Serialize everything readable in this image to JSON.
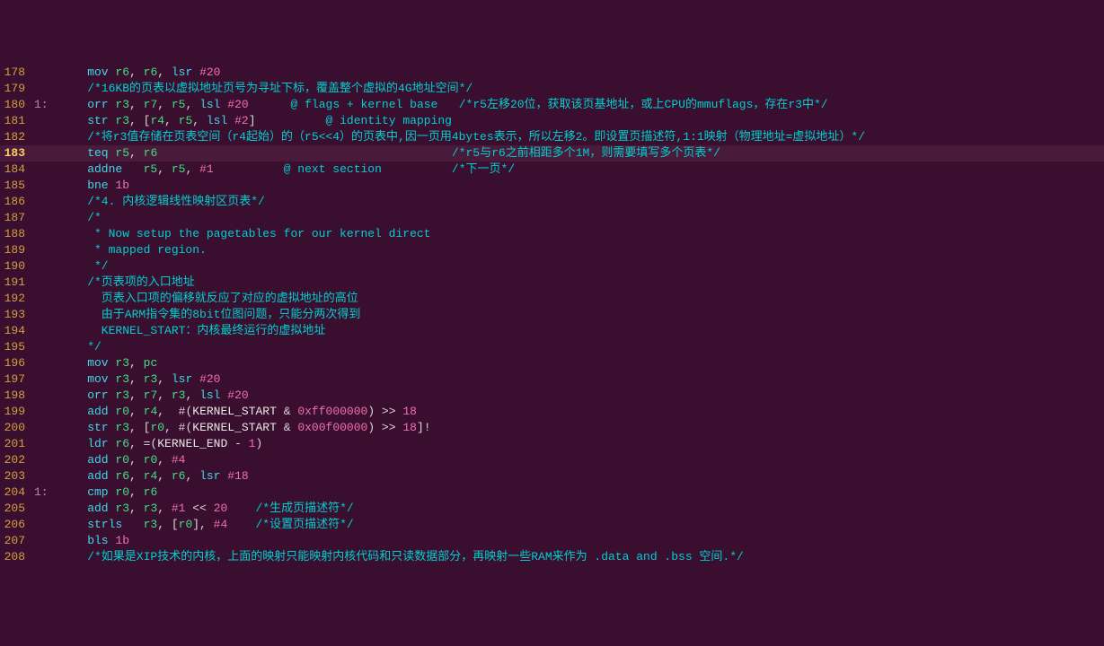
{
  "lines": [
    {
      "n": 178,
      "lbl": "",
      "hl": false,
      "seg": [
        [
          "inst",
          "    mov "
        ],
        [
          "reg",
          "r6"
        ],
        [
          "punc",
          ", "
        ],
        [
          "reg",
          "r6"
        ],
        [
          "punc",
          ", "
        ],
        [
          "inst",
          "lsr "
        ],
        [
          "num",
          "#20"
        ]
      ]
    },
    {
      "n": 179,
      "lbl": "",
      "hl": false,
      "seg": [
        [
          "com",
          "    /*16KB的页表以虚拟地址页号为寻址下标，覆盖整个虚拟的4G地址空间*/"
        ]
      ]
    },
    {
      "n": 180,
      "lbl": "1:",
      "hl": false,
      "seg": [
        [
          "inst",
          "    orr "
        ],
        [
          "reg",
          "r3"
        ],
        [
          "punc",
          ", "
        ],
        [
          "reg",
          "r7"
        ],
        [
          "punc",
          ", "
        ],
        [
          "reg",
          "r5"
        ],
        [
          "punc",
          ", "
        ],
        [
          "inst",
          "lsl "
        ],
        [
          "num",
          "#20"
        ],
        [
          "punc",
          "      "
        ],
        [
          "at",
          "@ flags + kernel base"
        ],
        [
          "punc",
          "   "
        ],
        [
          "com",
          "/*r5左移20位，获取该页基地址，或上CPU的mmuflags，存在r3中*/"
        ]
      ]
    },
    {
      "n": 181,
      "lbl": "",
      "hl": false,
      "seg": [
        [
          "inst",
          "    str "
        ],
        [
          "reg",
          "r3"
        ],
        [
          "punc",
          ", ["
        ],
        [
          "reg",
          "r4"
        ],
        [
          "punc",
          ", "
        ],
        [
          "reg",
          "r5"
        ],
        [
          "punc",
          ", "
        ],
        [
          "inst",
          "lsl "
        ],
        [
          "num",
          "#2"
        ],
        [
          "punc",
          "]          "
        ],
        [
          "at",
          "@ identity mapping"
        ]
      ]
    },
    {
      "n": 182,
      "lbl": "",
      "hl": false,
      "seg": [
        [
          "com",
          "    /*将r3值存储在页表空间（r4起始）的（r5<<4）的页表中,因一页用4bytes表示，所以左移2。即设置页描述符,1:1映射（物理地址=虚拟地址）*/"
        ]
      ]
    },
    {
      "n": 183,
      "lbl": "",
      "hl": true,
      "seg": [
        [
          "inst",
          "    teq "
        ],
        [
          "reg",
          "r5"
        ],
        [
          "punc",
          ", "
        ],
        [
          "reg",
          "r6"
        ],
        [
          "punc",
          "                                          "
        ],
        [
          "com",
          "/*r5与r6之前相距多个1M，则需要填写多个页表*/"
        ]
      ]
    },
    {
      "n": 184,
      "lbl": "",
      "hl": false,
      "seg": [
        [
          "inst",
          "    addne   "
        ],
        [
          "reg",
          "r5"
        ],
        [
          "punc",
          ", "
        ],
        [
          "reg",
          "r5"
        ],
        [
          "punc",
          ", "
        ],
        [
          "num",
          "#1"
        ],
        [
          "punc",
          "          "
        ],
        [
          "at",
          "@ next section"
        ],
        [
          "punc",
          "          "
        ],
        [
          "com",
          "/*下一页*/"
        ]
      ]
    },
    {
      "n": 185,
      "lbl": "",
      "hl": false,
      "seg": [
        [
          "inst",
          "    bne "
        ],
        [
          "num",
          "1b"
        ]
      ]
    },
    {
      "n": 186,
      "lbl": "",
      "hl": false,
      "seg": [
        [
          "com",
          "    /*4. 内核逻辑线性映射区页表*/"
        ]
      ]
    },
    {
      "n": 187,
      "lbl": "",
      "hl": false,
      "seg": [
        [
          "com",
          "    /*"
        ]
      ]
    },
    {
      "n": 188,
      "lbl": "",
      "hl": false,
      "seg": [
        [
          "com",
          "     * Now setup the pagetables for our kernel direct"
        ]
      ]
    },
    {
      "n": 189,
      "lbl": "",
      "hl": false,
      "seg": [
        [
          "com",
          "     * mapped region."
        ]
      ]
    },
    {
      "n": 190,
      "lbl": "",
      "hl": false,
      "seg": [
        [
          "com",
          "     */"
        ]
      ]
    },
    {
      "n": 191,
      "lbl": "",
      "hl": false,
      "seg": [
        [
          "com",
          "    /*页表项的入口地址"
        ]
      ]
    },
    {
      "n": 192,
      "lbl": "",
      "hl": false,
      "seg": [
        [
          "com",
          "      页表入口项的偏移就反应了对应的虚拟地址的高位"
        ]
      ]
    },
    {
      "n": 193,
      "lbl": "",
      "hl": false,
      "seg": [
        [
          "com",
          "      由于ARM指令集的8bit位图问题，只能分两次得到"
        ]
      ]
    },
    {
      "n": 194,
      "lbl": "",
      "hl": false,
      "seg": [
        [
          "com",
          "      KERNEL_START：内核最终运行的虚拟地址"
        ]
      ]
    },
    {
      "n": 195,
      "lbl": "",
      "hl": false,
      "seg": [
        [
          "com",
          "    */"
        ]
      ]
    },
    {
      "n": 196,
      "lbl": "",
      "hl": false,
      "seg": [
        [
          "inst",
          "    mov "
        ],
        [
          "reg",
          "r3"
        ],
        [
          "punc",
          ", "
        ],
        [
          "reg",
          "pc"
        ]
      ]
    },
    {
      "n": 197,
      "lbl": "",
      "hl": false,
      "seg": [
        [
          "inst",
          "    mov "
        ],
        [
          "reg",
          "r3"
        ],
        [
          "punc",
          ", "
        ],
        [
          "reg",
          "r3"
        ],
        [
          "punc",
          ", "
        ],
        [
          "inst",
          "lsr "
        ],
        [
          "num",
          "#20"
        ]
      ]
    },
    {
      "n": 198,
      "lbl": "",
      "hl": false,
      "seg": [
        [
          "inst",
          "    orr "
        ],
        [
          "reg",
          "r3"
        ],
        [
          "punc",
          ", "
        ],
        [
          "reg",
          "r7"
        ],
        [
          "punc",
          ", "
        ],
        [
          "reg",
          "r3"
        ],
        [
          "punc",
          ", "
        ],
        [
          "inst",
          "lsl "
        ],
        [
          "num",
          "#20"
        ]
      ]
    },
    {
      "n": 199,
      "lbl": "",
      "hl": false,
      "seg": [
        [
          "inst",
          "    add "
        ],
        [
          "reg",
          "r0"
        ],
        [
          "punc",
          ", "
        ],
        [
          "reg",
          "r4"
        ],
        [
          "punc",
          ",  "
        ],
        [
          "op",
          "#"
        ],
        [
          "punc",
          "("
        ],
        [
          "id",
          "KERNEL_START"
        ],
        [
          "punc",
          " & "
        ],
        [
          "num",
          "0xff000000"
        ],
        [
          "punc",
          ") >> "
        ],
        [
          "num",
          "18"
        ]
      ]
    },
    {
      "n": 200,
      "lbl": "",
      "hl": false,
      "seg": [
        [
          "inst",
          "    str "
        ],
        [
          "reg",
          "r3"
        ],
        [
          "punc",
          ", ["
        ],
        [
          "reg",
          "r0"
        ],
        [
          "punc",
          ", "
        ],
        [
          "op",
          "#"
        ],
        [
          "punc",
          "("
        ],
        [
          "id",
          "KERNEL_START"
        ],
        [
          "punc",
          " & "
        ],
        [
          "num",
          "0x00f00000"
        ],
        [
          "punc",
          ") >> "
        ],
        [
          "num",
          "18"
        ],
        [
          "punc",
          "]!"
        ]
      ]
    },
    {
      "n": 201,
      "lbl": "",
      "hl": false,
      "seg": [
        [
          "inst",
          "    ldr "
        ],
        [
          "reg",
          "r6"
        ],
        [
          "punc",
          ", =("
        ],
        [
          "id",
          "KERNEL_END"
        ],
        [
          "punc",
          " - "
        ],
        [
          "num",
          "1"
        ],
        [
          "punc",
          ")"
        ]
      ]
    },
    {
      "n": 202,
      "lbl": "",
      "hl": false,
      "seg": [
        [
          "inst",
          "    add "
        ],
        [
          "reg",
          "r0"
        ],
        [
          "punc",
          ", "
        ],
        [
          "reg",
          "r0"
        ],
        [
          "punc",
          ", "
        ],
        [
          "num",
          "#4"
        ]
      ]
    },
    {
      "n": 203,
      "lbl": "",
      "hl": false,
      "seg": [
        [
          "inst",
          "    add "
        ],
        [
          "reg",
          "r6"
        ],
        [
          "punc",
          ", "
        ],
        [
          "reg",
          "r4"
        ],
        [
          "punc",
          ", "
        ],
        [
          "reg",
          "r6"
        ],
        [
          "punc",
          ", "
        ],
        [
          "inst",
          "lsr "
        ],
        [
          "num",
          "#18"
        ]
      ]
    },
    {
      "n": 204,
      "lbl": "1:",
      "hl": false,
      "seg": [
        [
          "inst",
          "    cmp "
        ],
        [
          "reg",
          "r0"
        ],
        [
          "punc",
          ", "
        ],
        [
          "reg",
          "r6"
        ]
      ]
    },
    {
      "n": 205,
      "lbl": "",
      "hl": false,
      "seg": [
        [
          "inst",
          "    add "
        ],
        [
          "reg",
          "r3"
        ],
        [
          "punc",
          ", "
        ],
        [
          "reg",
          "r3"
        ],
        [
          "punc",
          ", "
        ],
        [
          "num",
          "#1"
        ],
        [
          "punc",
          " << "
        ],
        [
          "num",
          "20"
        ],
        [
          "punc",
          "    "
        ],
        [
          "com",
          "/*生成页描述符*/"
        ]
      ]
    },
    {
      "n": 206,
      "lbl": "",
      "hl": false,
      "seg": [
        [
          "inst",
          "    strls   "
        ],
        [
          "reg",
          "r3"
        ],
        [
          "punc",
          ", ["
        ],
        [
          "reg",
          "r0"
        ],
        [
          "punc",
          "], "
        ],
        [
          "num",
          "#4"
        ],
        [
          "punc",
          "    "
        ],
        [
          "com",
          "/*设置页描述符*/"
        ]
      ]
    },
    {
      "n": 207,
      "lbl": "",
      "hl": false,
      "seg": [
        [
          "inst",
          "    bls "
        ],
        [
          "num",
          "1b"
        ]
      ]
    },
    {
      "n": 208,
      "lbl": "",
      "hl": false,
      "seg": [
        [
          "com",
          "    /*如果是XIP技术的内核，上面的映射只能映射内核代码和只读数据部分，再映射一些RAM来作为 .data and .bss 空间.*/"
        ]
      ]
    }
  ]
}
